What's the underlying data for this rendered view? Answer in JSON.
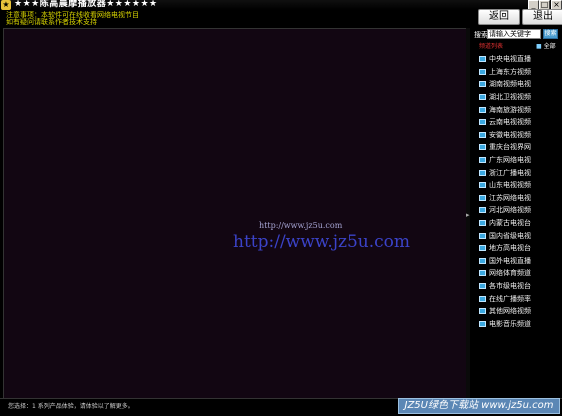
{
  "window": {
    "title": "★★★陈高晨摩播放器★★★★★★",
    "minimize_glyph": "_",
    "maximize_glyph": "□",
    "close_glyph": "×"
  },
  "notices": {
    "line1": "注意事项：本软件可在线收看网络电视节目",
    "line2": "如有疑问请联系作者技术支持"
  },
  "toolbar": {
    "back_label": "返回",
    "exit_label": "退出"
  },
  "video": {
    "watermark_small": "http://www.jz5u.com",
    "watermark_large": "http://www.jz5u.com"
  },
  "sidebar": {
    "search_label": "搜索",
    "search_value": "请输入关键字",
    "search_button": "搜索",
    "list_header": "频道列表",
    "all_link": "全部",
    "channels": [
      "中央电视直播",
      "上海东方视频",
      "湖南视频电视",
      "湖北卫视视频",
      "海南旅游视频",
      "云南电视视频",
      "安徽电视视频",
      "重庆台视界网",
      "广东网络电视",
      "浙江广播电视",
      "山东电视视频",
      "江苏网络电视",
      "河北网络视频",
      "内蒙古电视台",
      "国内省级电视",
      "地方高电视台",
      "国外电视直播",
      "网络体育频道",
      "各市级电视台",
      "在线广播频率",
      "其他网络视频",
      "电影音乐频道"
    ]
  },
  "status": {
    "text": "您选择：1 系列产品体验，请体验以了解更多。"
  },
  "watermark": {
    "text": "JZ5U绿色下载站 www.jz5u.com"
  },
  "colors": {
    "video_bg": "#120612",
    "notice": "#d8d400",
    "accent": "#3aa8e0",
    "list_header": "#e03030"
  }
}
